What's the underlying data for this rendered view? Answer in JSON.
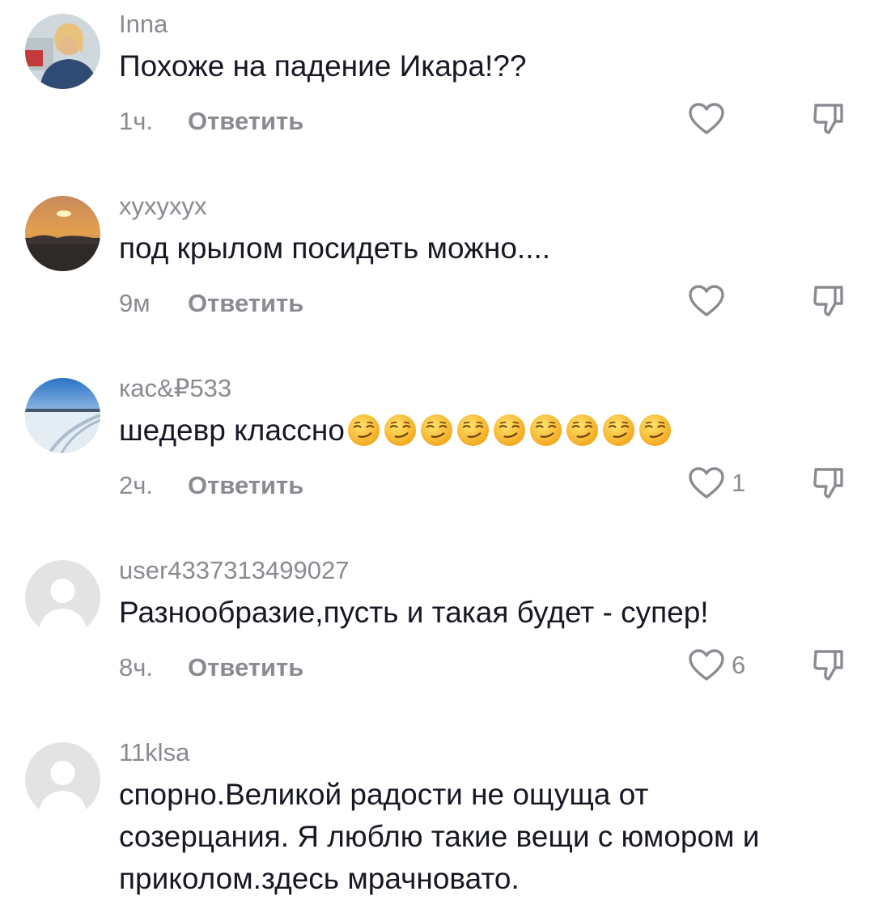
{
  "comments": [
    {
      "username": "Inna",
      "text": "Похоже на падение Икара!??",
      "time": "1ч.",
      "reply_label": "Ответить",
      "likes": "",
      "avatar": "photo-woman"
    },
    {
      "username": "хухухух",
      "text": "под крылом посидеть можно....",
      "time": "9м",
      "reply_label": "Ответить",
      "likes": "",
      "avatar": "photo-sunset"
    },
    {
      "username": "кас&₽533",
      "text": "шедевр классно",
      "emoji_count": 9,
      "emoji": "smirking-face",
      "time": "2ч.",
      "reply_label": "Ответить",
      "likes": "1",
      "avatar": "photo-snow"
    },
    {
      "username": "user4337313499027",
      "text": "Разнообразие,пусть и такая будет - супер!",
      "time": "8ч.",
      "reply_label": "Ответить",
      "likes": "6",
      "avatar": "default-avatar"
    },
    {
      "username": "11klsa",
      "text": "спорно.Великой радости не ощуща от созерцания. Я люблю такие вещи с юмором и приколом.здесь мрачновато.",
      "avatar": "default-avatar"
    }
  ],
  "icons": {
    "like": "heart-outline-icon",
    "dislike": "thumbs-down-icon"
  },
  "colors": {
    "text": "#161823",
    "secondary": "#8a8b91",
    "icon": "#8a8b91"
  }
}
